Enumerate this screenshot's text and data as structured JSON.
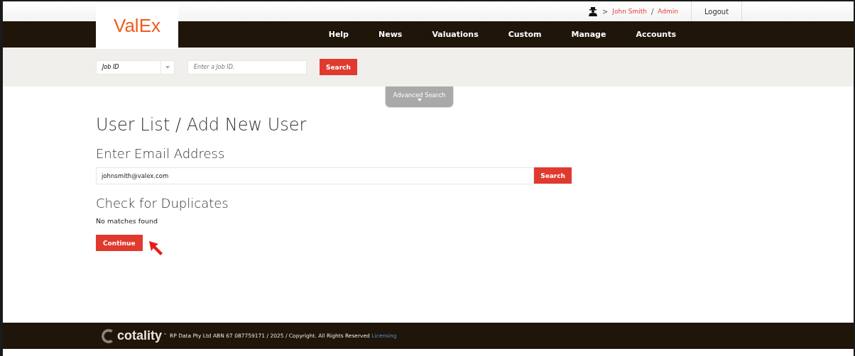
{
  "header": {
    "logo": "ValEx",
    "user": {
      "separator": ">",
      "name": "John Smith",
      "slash": "/",
      "role": "Admin"
    },
    "logout": "Logout",
    "nav": [
      "Help",
      "News",
      "Valuations",
      "Custom",
      "Manage",
      "Accounts"
    ]
  },
  "quick_search": {
    "type_select": "Job ID",
    "placeholder": "Enter a Job ID.",
    "button": "Search",
    "advanced": "Advanced Search"
  },
  "page": {
    "title": "User List / Add New User",
    "email_heading": "Enter Email Address",
    "email_value": "johnsmith@valex.com",
    "email_button": "Search",
    "duplicates_heading": "Check for Duplicates",
    "result": "No matches found",
    "continue": "Continue"
  },
  "footer": {
    "logo": "cotality",
    "tm": "™",
    "text": "RP Data Pty Ltd ABN 67 087759171 / 2025 / Copyright. All Rights Reserved",
    "link": "Licensing"
  }
}
